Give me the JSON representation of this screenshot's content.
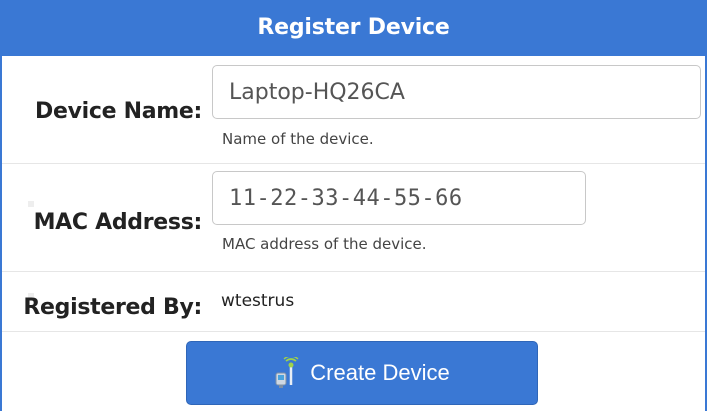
{
  "form": {
    "title": "Register Device",
    "device_name": {
      "label": "Device Name:",
      "value": "Laptop-HQ26CA",
      "hint": "Name of the device."
    },
    "mac_address": {
      "label": "MAC Address:",
      "value": "11-22-33-44-55-66",
      "hint": "MAC address of the device."
    },
    "registered_by": {
      "label": "Registered By:",
      "value": "wtestrus"
    },
    "create_button": {
      "label": "Create Device",
      "icon": "device-antenna-icon"
    }
  },
  "colors": {
    "accent": "#3a78d4",
    "border": "#c8c8c8",
    "text": "#222222"
  }
}
